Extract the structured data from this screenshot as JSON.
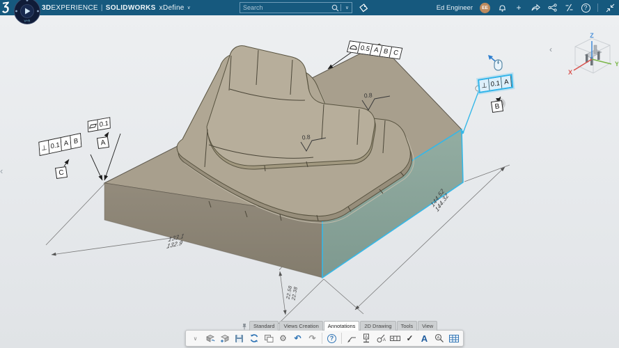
{
  "topbar": {
    "brand": {
      "bold": "3D",
      "rest": "EXPERIENCE",
      "sep": "|",
      "app": "SOLIDWORKS",
      "module": "xDefine"
    },
    "search_placeholder": "Search",
    "user_name": "Ed Engineer",
    "user_initials": "EE"
  },
  "glyphs": {
    "chevron_down": "∨",
    "chevron_left": "‹",
    "plus": "+",
    "help": "?",
    "gear": "⚙",
    "undo": "↶",
    "redo": "↷",
    "check": "✓",
    "note_a": "A"
  },
  "compass": {
    "label": "V+R"
  },
  "annotations": {
    "fcf_profile": {
      "symbol": "surface-profile",
      "tol": "0.5",
      "d1": "A",
      "d2": "B",
      "d3": "C"
    },
    "fcf_flatness": {
      "symbol": "flatness",
      "tol": "0.1",
      "datum": "A"
    },
    "fcf_perp_left": {
      "symbol": "perpendicularity",
      "sym": "⊥",
      "tol": "0.1",
      "d1": "A",
      "d2": "B",
      "datum": "C"
    },
    "fcf_perp_selected": {
      "symbol": "perpendicularity",
      "sym": "⊥",
      "tol": "0.1",
      "d1": "A",
      "datum": "B",
      "selected": true
    },
    "sf1": "0.8",
    "sf2": "0.8"
  },
  "dims": {
    "width": {
      "hi": "133.1",
      "lo": "132.9"
    },
    "depth": {
      "hi": "144.52",
      "lo": "144.32"
    },
    "height": {
      "hi": "22.58",
      "lo": "22.38"
    }
  },
  "triad": {
    "x": "X",
    "y": "Y",
    "z": "Z"
  },
  "bottom": {
    "tabs": [
      {
        "label": "Standard"
      },
      {
        "label": "Views Creation"
      },
      {
        "label": "Annotations",
        "active": true
      },
      {
        "label": "2D Drawing"
      },
      {
        "label": "Tools"
      },
      {
        "label": "View"
      }
    ]
  }
}
